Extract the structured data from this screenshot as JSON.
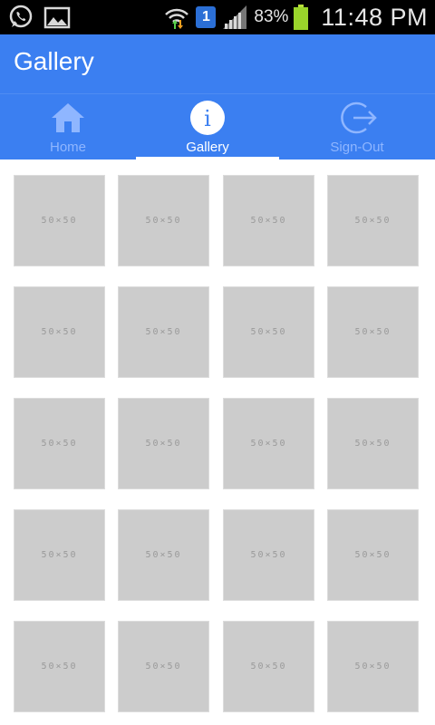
{
  "status_bar": {
    "battery_percent": "83%",
    "time": "11:48 PM",
    "notification_badge": "1",
    "icons": [
      "whatsapp-icon",
      "image-icon",
      "wifi-icon",
      "notification-badge-icon",
      "signal-icon",
      "battery-icon"
    ]
  },
  "action_bar": {
    "title": "Gallery"
  },
  "tabs": [
    {
      "label": "Home",
      "icon": "home-icon",
      "active": false
    },
    {
      "label": "Gallery",
      "icon": "info-icon",
      "active": true
    },
    {
      "label": "Sign-Out",
      "icon": "sign-out-icon",
      "active": false
    }
  ],
  "gallery": {
    "placeholder_label": "50×50",
    "rows": 5,
    "columns": 4
  },
  "colors": {
    "primary": "#3b7ff1",
    "status_bar": "#000000",
    "thumb": "#cccccc",
    "inactive_tab": "#8fb6ff"
  }
}
